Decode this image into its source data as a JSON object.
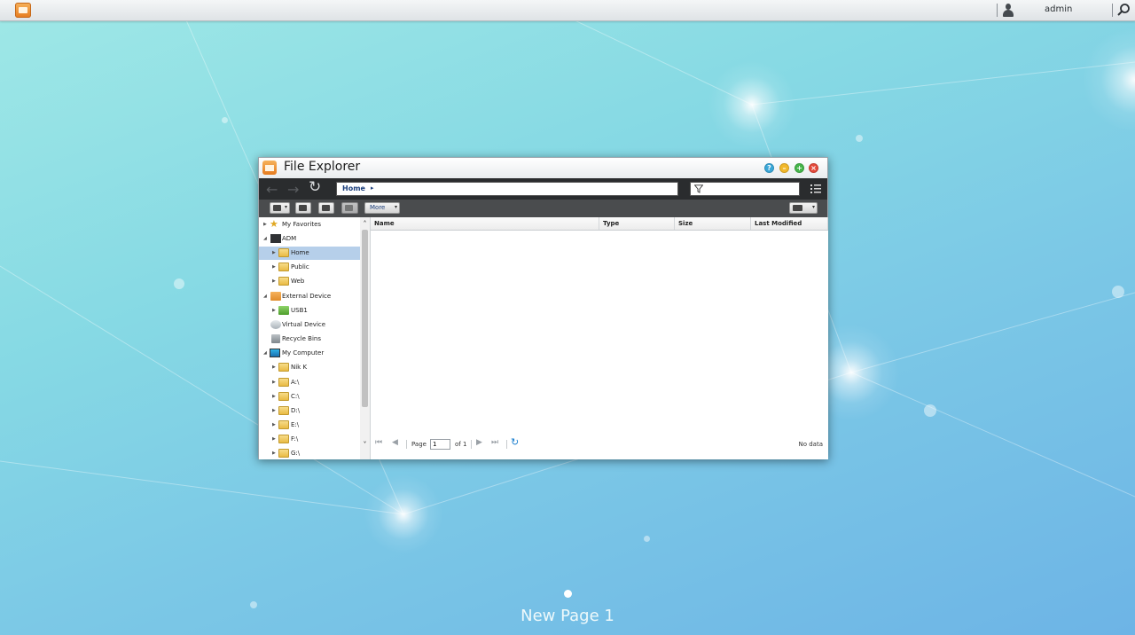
{
  "topbar": {
    "username": "admin"
  },
  "window": {
    "title": "File Explorer",
    "buttons": {
      "help": "?",
      "minimize": "–",
      "maximize": "+",
      "close": "×"
    },
    "address": {
      "crumb": "Home",
      "carat": "▸"
    },
    "toolbar": {
      "more_label": "More"
    }
  },
  "tree": {
    "items": [
      {
        "label": "My Favorites"
      },
      {
        "label": "ADM"
      },
      {
        "label": "Home"
      },
      {
        "label": "Public"
      },
      {
        "label": "Web"
      },
      {
        "label": "External Device"
      },
      {
        "label": "USB1"
      },
      {
        "label": "Virtual Device"
      },
      {
        "label": "Recycle Bins"
      },
      {
        "label": "My Computer"
      },
      {
        "label": "Nik K"
      },
      {
        "label": "A:\\"
      },
      {
        "label": "C:\\"
      },
      {
        "label": "D:\\"
      },
      {
        "label": "E:\\"
      },
      {
        "label": "F:\\"
      },
      {
        "label": "G:\\"
      }
    ]
  },
  "grid": {
    "columns": [
      "Name",
      "Type",
      "Size",
      "Last Modified"
    ]
  },
  "pager": {
    "page_label": "Page",
    "page_value": "1",
    "of_label": "of 1",
    "status": "No data"
  },
  "desktop": {
    "page_name": "New Page 1"
  },
  "colors": {
    "accent": "#e67b1e",
    "selection": "#b6cfea",
    "help": "#3aa7d8",
    "minimize": "#f2b82a",
    "maximize": "#46b64a",
    "close": "#e54a3b"
  }
}
